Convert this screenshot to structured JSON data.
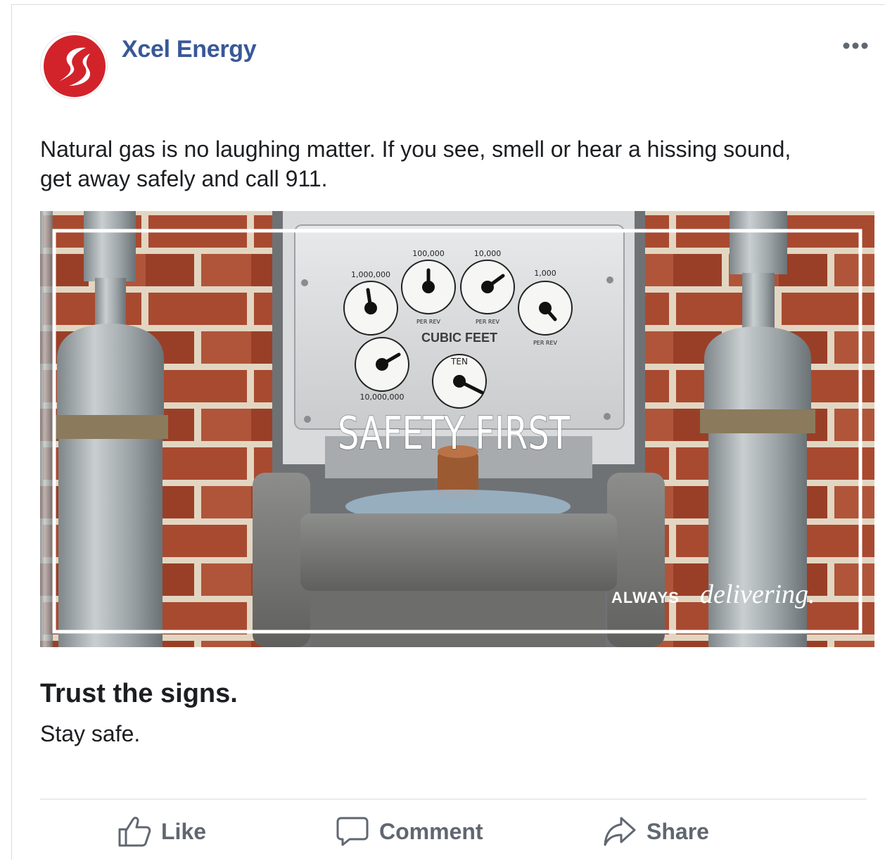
{
  "page": {
    "name": "Xcel Energy"
  },
  "post": {
    "text": "Natural gas is no laughing matter. If you see, smell or hear a hissing sound, get away safely and call 911."
  },
  "media": {
    "overlay_title": "SAFETY FIRST",
    "tagline_caps": "ALWAYS",
    "tagline_script": "delivering.",
    "meter": {
      "label": "CUBIC FEET",
      "dial_units": [
        "1,000,000",
        "100,000",
        "10,000",
        "1,000",
        "10,000,000"
      ],
      "dial_sublabel": "PER REV",
      "test_dial_label": "TEN"
    }
  },
  "link": {
    "headline": "Trust the signs.",
    "description": "Stay safe."
  },
  "actions": {
    "like": "Like",
    "comment": "Comment",
    "share": "Share"
  },
  "icons": {
    "more": "more-options-icon",
    "like": "thumbs-up-icon",
    "comment": "speech-bubble-icon",
    "share": "share-arrow-icon",
    "logo": "xcel-energy-logo"
  },
  "colors": {
    "link_blue": "#385898",
    "brand_red": "#d2232a",
    "action_gray": "#606770",
    "text": "#1c1e21"
  }
}
